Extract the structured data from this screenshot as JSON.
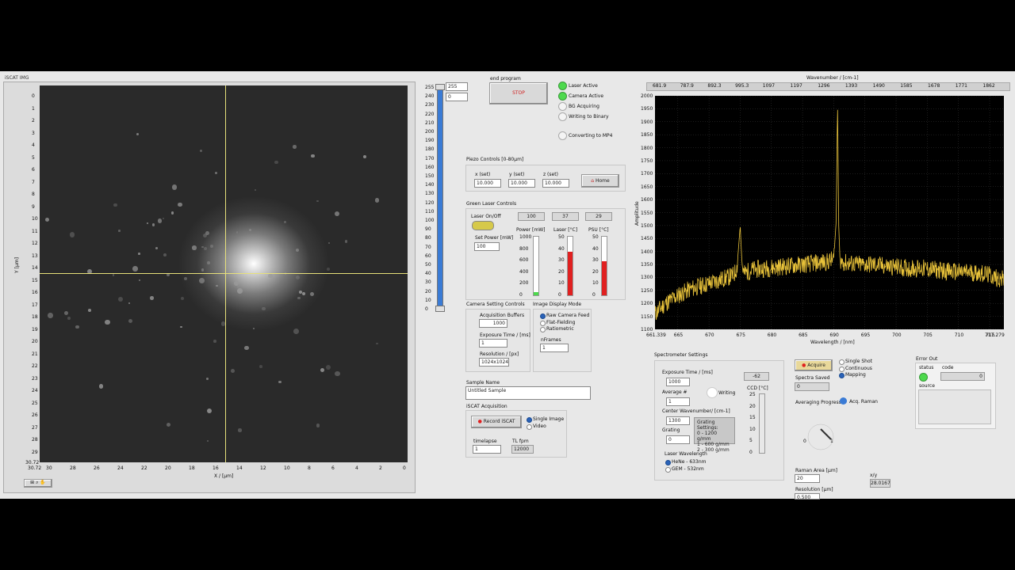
{
  "image_panel": {
    "title": "iSCAT IMG",
    "y_label": "Y [μm]",
    "x_label": "X / [μm]",
    "y_ticks": [
      "0",
      "1",
      "2",
      "3",
      "4",
      "5",
      "6",
      "7",
      "8",
      "9",
      "10",
      "11",
      "12",
      "13",
      "14",
      "15",
      "16",
      "17",
      "18",
      "19",
      "20",
      "21",
      "22",
      "23",
      "24",
      "25",
      "26",
      "27",
      "28",
      "29",
      "30.72"
    ],
    "x_ticks": [
      "30.72",
      "30",
      "28",
      "26",
      "24",
      "22",
      "20",
      "18",
      "16",
      "14",
      "12",
      "10",
      "8",
      "6",
      "4",
      "2",
      "0"
    ],
    "y_bottom_label": "30",
    "cursor_x": 15.2,
    "cursor_y": 15.0
  },
  "colormap": {
    "max_value": "255",
    "min_value": "0",
    "ticks": [
      "255",
      "240",
      "230",
      "220",
      "210",
      "200",
      "190",
      "180",
      "170",
      "160",
      "150",
      "140",
      "130",
      "120",
      "110",
      "100",
      "90",
      "80",
      "70",
      "60",
      "50",
      "40",
      "30",
      "20",
      "10",
      "0"
    ],
    "slider_level": 1.0
  },
  "end_program": {
    "label": "end program",
    "button": "STOP"
  },
  "status": [
    {
      "label": "Laser Active",
      "on": true
    },
    {
      "label": "Camera Active",
      "on": true
    },
    {
      "label": "BG Acquiring",
      "on": false
    },
    {
      "label": "Writing to Binary",
      "on": false
    },
    {
      "label": "Converting to MP4",
      "on": false
    }
  ],
  "piezo": {
    "title": "Piezo Controls [0-80μm]",
    "x_label": "x (set)",
    "x_value": "10.000",
    "y_label": "y (set)",
    "y_value": "10.000",
    "z_label": "z (set)",
    "z_value": "10.000",
    "home_button": "Home"
  },
  "green_laser": {
    "title": "Green Laser Controls",
    "onoff_label": "Laser On/Off",
    "set_power_label": "Set Power [mW]",
    "set_power_value": "100",
    "power_display": "100",
    "laser_temp_display": "37",
    "psu_temp_display": "29",
    "power_label": "Power [mW]",
    "laser_label": "Laser [°C]",
    "psu_label": "PSU [°C]",
    "power_ticks": [
      "1000",
      "800",
      "600",
      "400",
      "200",
      "0"
    ],
    "temp_ticks": [
      "50",
      "40",
      "30",
      "20",
      "10",
      "0"
    ],
    "power_level": 0.0,
    "laser_level": 0.74,
    "psu_level": 0.58
  },
  "camera": {
    "title": "Camera Setting Controls",
    "buffers_label": "Acquisition Buffers",
    "buffers_value": "1000",
    "exposure_label": "Exposure Time / [ms]",
    "exposure_value": "1",
    "resolution_label": "Resolution / [px]",
    "resolution_value": "1024x1024"
  },
  "display_mode": {
    "title": "Image Display Mode",
    "options": [
      "Raw Camera Feed",
      "Flat-Fielding",
      "Ratiometric"
    ],
    "selected": 0,
    "nframes_label": "nFrames",
    "nframes_value": "1"
  },
  "sample": {
    "label": "Sample Name",
    "value": "Untitled Sample"
  },
  "iscat_acq": {
    "title": "iSCAT Acquisition",
    "record_button": "Record iSCAT",
    "modes": [
      "Single Image",
      "Video"
    ],
    "timelapse_label": "timelapse",
    "timelapse_value": "1",
    "tl_fpm_label": "TL fpm",
    "tl_fpm_value": "12000"
  },
  "spectrum": {
    "top_axis_title": "Wavenumber / [cm-1]",
    "top_ticks": [
      "681.9",
      "787.9",
      "892.3",
      "995.3",
      "1097",
      "1197",
      "1296",
      "1393",
      "1490",
      "1585",
      "1678",
      "1771",
      "1862"
    ],
    "y_label": "Amplitude",
    "x_label": "Wavelength / [nm]",
    "x_min_label": "661.339",
    "x_max_label": "717.279",
    "x_ticks": [
      "665",
      "670",
      "675",
      "680",
      "685",
      "690",
      "695",
      "700",
      "705",
      "710",
      "715"
    ],
    "y_ticks": [
      "2000",
      "1950",
      "1900",
      "1850",
      "1800",
      "1750",
      "1700",
      "1650",
      "1600",
      "1550",
      "1500",
      "1450",
      "1400",
      "1350",
      "1300",
      "1250",
      "1200",
      "1150",
      "1100"
    ]
  },
  "chart_data": {
    "type": "line",
    "xlabel": "Wavelength / [nm]",
    "ylabel": "Amplitude",
    "xlim": [
      661.339,
      717.279
    ],
    "ylim": [
      1100,
      2000
    ],
    "series": [
      {
        "x": [
          661.339,
          663,
          665,
          667,
          669,
          671,
          673,
          674,
          674.5,
          675,
          675.3,
          675.6,
          676,
          677,
          679,
          681,
          683,
          685,
          687,
          689,
          690,
          690.4,
          690.6,
          690.8,
          691,
          691.4,
          692,
          694,
          696,
          698,
          700,
          702,
          704,
          706,
          708,
          710,
          712,
          714,
          716,
          717.279
        ],
        "y": [
          1160,
          1200,
          1230,
          1255,
          1270,
          1285,
          1300,
          1310,
          1340,
          1500,
          1350,
          1315,
          1320,
          1330,
          1335,
          1340,
          1345,
          1350,
          1355,
          1360,
          1370,
          1520,
          1980,
          1500,
          1370,
          1360,
          1355,
          1350,
          1350,
          1345,
          1340,
          1335,
          1335,
          1330,
          1325,
          1320,
          1320,
          1315,
          1300,
          1290
        ]
      }
    ]
  },
  "spectrometer": {
    "title": "Spectrometer Settings",
    "exposure_label": "Exposure Time / [ms]",
    "exposure_value": "1000",
    "average_label": "Average #",
    "average_value": "1",
    "writing_label": "Writing",
    "center_label": "Center Wavenumber/ [cm-1]",
    "center_value": "1300",
    "grating_label": "Grating",
    "grating_value": "0",
    "grating_settings": [
      "Grating Settings:",
      "0 - 1200 g/mm",
      "1 - 600  g/mm",
      "2 - 300  g/mm"
    ],
    "ccd_value": "-62",
    "ccd_label": "CCD [°C]",
    "ccd_ticks": [
      "25",
      "20",
      "15",
      "10",
      "5",
      "0"
    ],
    "laser_wl_label": "Laser Wavelength",
    "laser_options": [
      "HeNe - 633nm",
      "GEM - 532nm"
    ],
    "laser_selected": 0
  },
  "acquire": {
    "button": "Acquire",
    "modes": [
      "Single Shot",
      "Continuous",
      "Mapping"
    ],
    "mode_selected": 2,
    "spectra_saved_label": "Spectra Saved",
    "spectra_saved_value": "0",
    "avg_progress_label": "Averaging Progress",
    "acq_raman_label": "Acq. Raman",
    "gauge_min": "0",
    "gauge_max": "1",
    "raman_area_label": "Raman Area [μm]",
    "raman_area_value": "20",
    "resolution_label": "Resolution [μm]",
    "resolution_value": "0.500",
    "xy_label": "x/y",
    "xy_value": "28.0167"
  },
  "error_out": {
    "title": "Error Out",
    "status_label": "status",
    "code_label": "code",
    "code_value": "0",
    "source_label": "source"
  },
  "colors": {
    "trace": "#e8c23a",
    "cursor": "#e7e07a",
    "led_on": "#4dd94d",
    "fill_red": "#e02020",
    "fill_green": "#4dd94d",
    "accent_blue": "#3a7bd5"
  }
}
